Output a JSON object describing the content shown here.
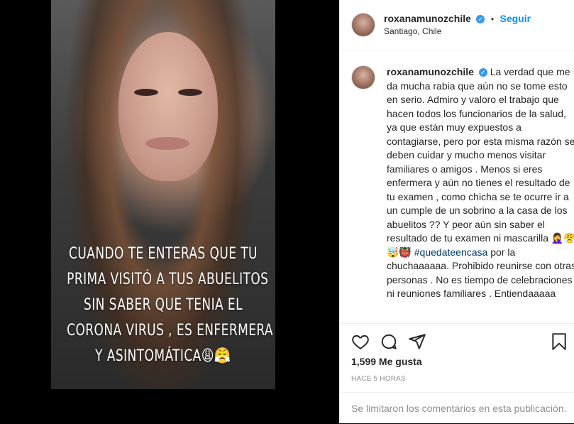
{
  "post": {
    "username": "roxanamunozchile",
    "verified_symbol": "✓",
    "separator": "•",
    "follow_label": "Seguir",
    "location": "Santiago, Chile",
    "media_caption_lines": [
      "CUANDO TE ENTERAS QUE TU",
      "PRIMA VISITÓ A TUS ABUELITOS",
      "SIN SABER QUE TENIA EL",
      "CORONA VIRUS , ES ENFERMERA",
      "Y ASINTOMÁTICA😩😤"
    ],
    "caption_text": "La verdad que me da mucha rabia que aún no se tome esto en serio. Admiro y valoro el trabajo que hacen todos los funcionarios de la salud, ya que están muy expuestos a contagiarse, pero por esta misma razón se deben cuidar y mucho menos visitar familiares o amigos . Menos si eres enfermera y aún no tienes el resultado de tu examen , como chicha se te ocurre ir a un cumple de un sobrino a la casa de los abuelitos ?? Y peor aún sin saber el resultado de tu examen ni mascarilla",
    "caption_emojis": "🤦‍♀️😤🤯👹",
    "hashtag": "#quedateencasa",
    "caption_tail": "por la chuchaaaaaa. Prohibido reunirse con otras personas . No es tiempo de celebraciones ni reuniones familiares . Entiendaaaaa",
    "likes": "1,599 Me gusta",
    "time_ago": "HACE 5 HORAS",
    "comments_disabled": "Se limitaron los comentarios en esta publicación."
  },
  "icons": [
    "heart-icon",
    "comment-icon",
    "share-icon",
    "bookmark-icon"
  ]
}
